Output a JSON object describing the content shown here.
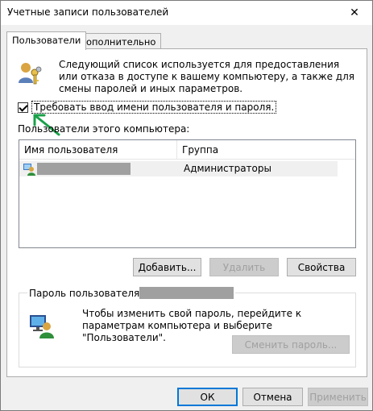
{
  "window": {
    "title": "Учетные записи пользователей",
    "close_glyph": "✕"
  },
  "tabs": [
    {
      "label": "Пользователи",
      "active": true
    },
    {
      "label": "Дополнительно",
      "active": false
    }
  ],
  "intro": {
    "text": "Следующий список используется для предоставления или отказа в доступе к вашему компьютеру, а также для смены паролей и иных параметров.",
    "icon": "users-keys-icon"
  },
  "require_login": {
    "label": "Требовать ввод имени пользователя и пароля.",
    "checked": true
  },
  "users_list": {
    "label": "Пользователи этого компьютера:",
    "columns": [
      "Имя пользователя",
      "Группа"
    ],
    "rows": [
      {
        "name": "",
        "group": "Администраторы",
        "icon": "user-icon"
      }
    ]
  },
  "list_buttons": {
    "add": "Добавить...",
    "remove": "Удалить",
    "properties": "Свойства"
  },
  "password_group": {
    "title": "Пароль пользователя",
    "text": "Чтобы изменить свой пароль, перейдите к параметрам компьютера и выберите \"Пользователи\".",
    "change_button": "Сменить пароль..."
  },
  "dialog_buttons": {
    "ok": "ОК",
    "cancel": "Отмена",
    "apply": "Применить"
  },
  "colors": {
    "arrow": "#1aa04a",
    "focus_border": "#0078d7"
  }
}
